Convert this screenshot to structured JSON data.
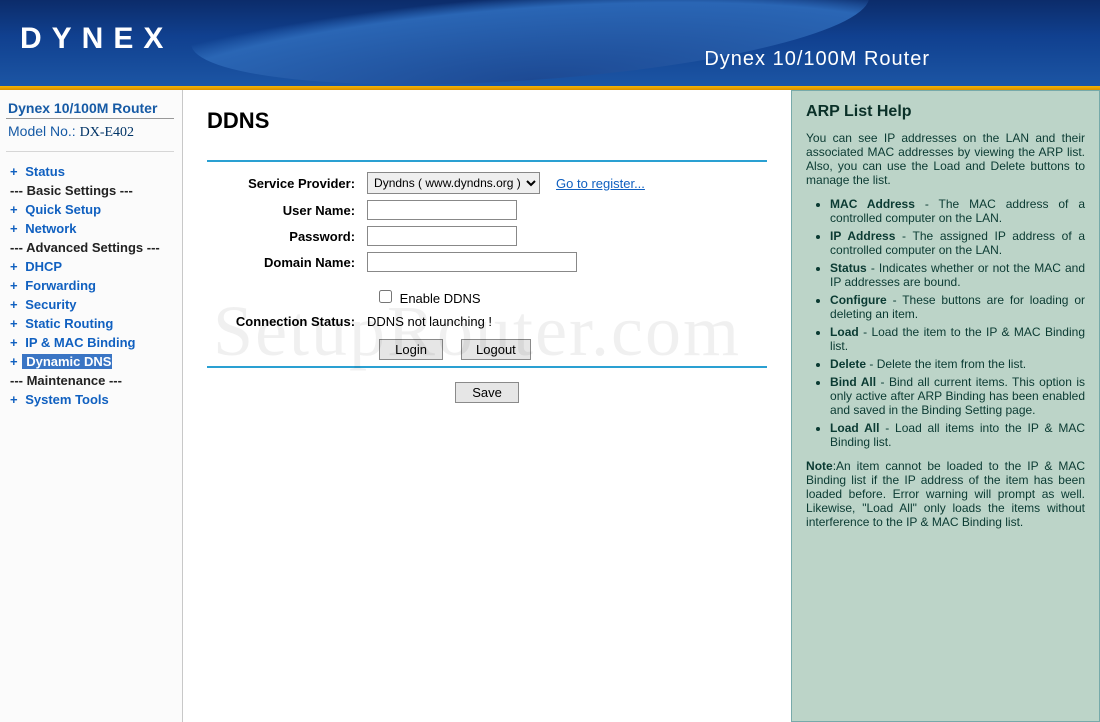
{
  "header": {
    "brand": "DYNEX",
    "title": "Dynex 10/100M Router"
  },
  "sidebar": {
    "product": "Dynex 10/100M Router",
    "model_label": "Model No.:",
    "model_value": "DX-E402",
    "items": [
      {
        "label": "Status",
        "type": "link"
      },
      {
        "label": "--- Basic Settings ---",
        "type": "heading"
      },
      {
        "label": "Quick Setup",
        "type": "link"
      },
      {
        "label": "Network",
        "type": "link"
      },
      {
        "label": "--- Advanced Settings ---",
        "type": "heading"
      },
      {
        "label": "DHCP",
        "type": "link"
      },
      {
        "label": "Forwarding",
        "type": "link"
      },
      {
        "label": "Security",
        "type": "link"
      },
      {
        "label": "Static Routing",
        "type": "link"
      },
      {
        "label": "IP & MAC Binding",
        "type": "link"
      },
      {
        "label": "Dynamic DNS",
        "type": "active"
      },
      {
        "label": "--- Maintenance ---",
        "type": "heading"
      },
      {
        "label": "System Tools",
        "type": "link"
      }
    ]
  },
  "page": {
    "title": "DDNS",
    "labels": {
      "service_provider": "Service Provider:",
      "user_name": "User Name:",
      "password": "Password:",
      "domain_name": "Domain Name:",
      "enable": "Enable DDNS",
      "connection_status": "Connection Status:"
    },
    "values": {
      "service_provider_option": "Dyndns ( www.dyndns.org )",
      "register_link": "Go to register...",
      "user_name": "",
      "password": "",
      "domain_name": "",
      "status": "DDNS not launching !"
    },
    "buttons": {
      "login": "Login",
      "logout": "Logout",
      "save": "Save"
    }
  },
  "help": {
    "title": "ARP List Help",
    "intro": "You can see IP addresses on the LAN and their associated MAC addresses by viewing the ARP list. Also, you can use the Load and Delete buttons to manage the list.",
    "items": [
      {
        "term": "MAC Address",
        "desc": " - The MAC address of a controlled computer on the LAN."
      },
      {
        "term": "IP Address",
        "desc": " - The assigned IP address of a controlled computer on the LAN."
      },
      {
        "term": "Status",
        "desc": " - Indicates whether or not the MAC and IP addresses are bound."
      },
      {
        "term": "Configure",
        "desc": " - These buttons are for loading or deleting an item."
      },
      {
        "term": "Load",
        "desc": " - Load the item to the IP & MAC Binding list."
      },
      {
        "term": "Delete",
        "desc": " - Delete the item from the list."
      },
      {
        "term": "Bind All",
        "desc": " - Bind all current items. This option is only active after ARP Binding has been enabled and saved in the Binding Setting page."
      },
      {
        "term": "Load All",
        "desc": " - Load all items into the IP & MAC Binding list."
      }
    ],
    "note_label": "Note",
    "note": ":An item cannot be loaded to the IP & MAC Binding list if the IP address of the item has been loaded before. Error warning will prompt as well. Likewise, \"Load All\" only loads the items without interference to the IP & MAC Binding list."
  },
  "watermark": "SetupRouter.com"
}
